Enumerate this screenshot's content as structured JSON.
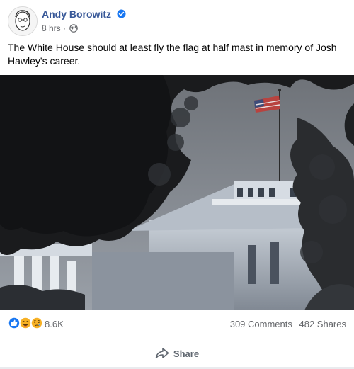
{
  "post": {
    "author": "Andy Borowitz",
    "timestamp": "8 hrs",
    "separator": "·",
    "privacy_icon": "globe-icon",
    "verified_icon": "verified-badge-icon",
    "text": "The White House should at least fly the flag at half mast in memory of Josh Hawley's career.",
    "image_subject": "White House with flag"
  },
  "engagement": {
    "reaction_icons": [
      "like-icon",
      "haha-icon",
      "sad-icon"
    ],
    "reaction_count": "8.6K",
    "comments": "309 Comments",
    "shares": "482 Shares"
  },
  "actions": {
    "share_label": "Share",
    "share_icon": "share-arrow-icon"
  },
  "colors": {
    "author_blue": "#385898",
    "verified_blue": "#1877f2",
    "meta_gray": "#65676b",
    "action_gray": "#606770"
  }
}
